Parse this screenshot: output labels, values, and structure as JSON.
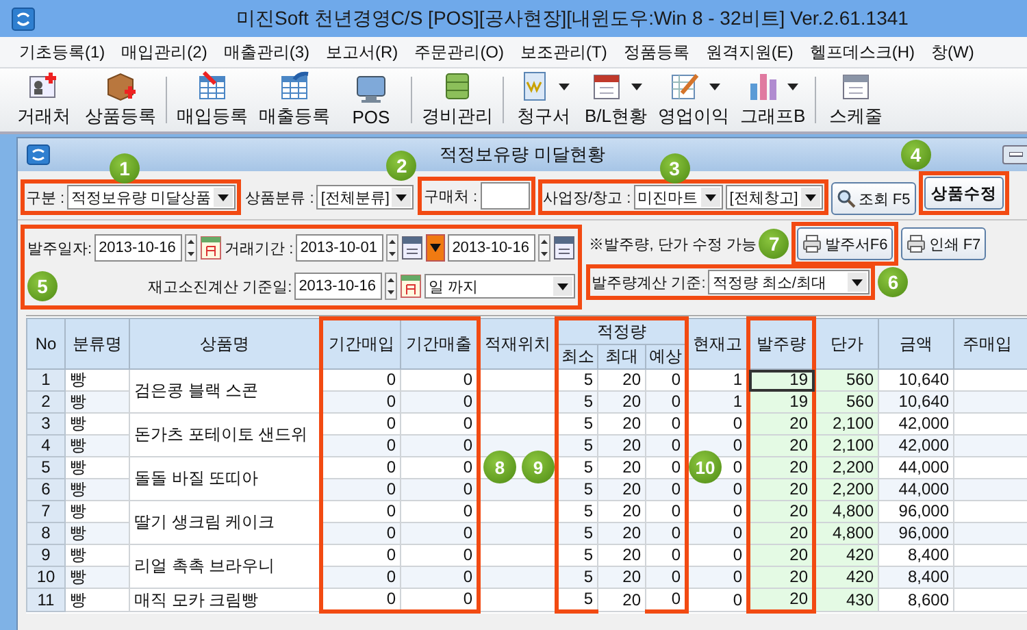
{
  "window": {
    "title": "미진Soft 천년경영C/S [POS][공사현장][내윈도우:Win 8 - 32비트] Ver.2.61.1341"
  },
  "menu": [
    "기초등록(1)",
    "매입관리(2)",
    "매출관리(3)",
    "보고서(R)",
    "주문관리(O)",
    "보조관리(T)",
    "정품등록",
    "원격지원(E)",
    "헬프데스크(H)",
    "창(W)"
  ],
  "toolbar": [
    {
      "kind": "button",
      "label": "거래처",
      "dropdown": false
    },
    {
      "kind": "button",
      "label": "상품등록",
      "dropdown": false
    },
    {
      "kind": "separator"
    },
    {
      "kind": "button",
      "label": "매입등록",
      "dropdown": false
    },
    {
      "kind": "button",
      "label": "매출등록",
      "dropdown": false
    },
    {
      "kind": "button",
      "label": "POS",
      "dropdown": false
    },
    {
      "kind": "separator"
    },
    {
      "kind": "button",
      "label": "경비관리",
      "dropdown": false
    },
    {
      "kind": "separator"
    },
    {
      "kind": "button",
      "label": "청구서",
      "dropdown": true
    },
    {
      "kind": "button",
      "label": "B/L현황",
      "dropdown": true
    },
    {
      "kind": "button",
      "label": "영업이익",
      "dropdown": true
    },
    {
      "kind": "button",
      "label": "그래프B",
      "dropdown": true
    },
    {
      "kind": "separator"
    },
    {
      "kind": "button",
      "label": "스케줄",
      "dropdown": false
    }
  ],
  "child_window": {
    "title": "적정보유량 미달현황"
  },
  "filter_row_1": {
    "type_label": "구분 :",
    "type_value": "적정보유량 미달상품",
    "category_label": "상품분류 :",
    "category_value": "[전체분류]",
    "supplier_label": "구매처 :",
    "site_label": "사업장/창고 :",
    "site_value": "미진마트",
    "warehouse_value": "[전체창고]",
    "search_button": "조회 F5",
    "edit_button": "상품수정"
  },
  "filter_row_2": {
    "order_date_label": "발주일자:",
    "order_date": "2013-10-16",
    "period_label": "거래기간 :",
    "period_from": "2013-10-01",
    "period_to": "2013-10-16",
    "note": "※발주량, 단가 수정 가능",
    "order_sheet_button": "발주서F6",
    "print_button": "인쇄 F7"
  },
  "filter_row_3": {
    "base_date_label": "재고소진계산 기준일:",
    "base_date": "2013-10-16",
    "until_value": "일 까지",
    "calc_label": "발주량계산 기준:",
    "calc_value": "적정량 최소/최대"
  },
  "table": {
    "columns": [
      {
        "label": "No"
      },
      {
        "label": "분류명"
      },
      {
        "label": "상품명"
      },
      {
        "label": "기간매입"
      },
      {
        "label": "기간매출"
      },
      {
        "label": "적재위치"
      },
      {
        "label": "적정량",
        "children": [
          {
            "label": "최소"
          },
          {
            "label": "최대"
          },
          {
            "label": "예상"
          }
        ]
      },
      {
        "label": "현재고"
      },
      {
        "label": "발주량"
      },
      {
        "label": "단가"
      },
      {
        "label": "금액"
      },
      {
        "label": "주매입"
      }
    ],
    "products": [
      {
        "name": "검은콩 블랙 스콘",
        "rows": [
          {
            "no": "1",
            "category": "빵",
            "cells": [
              "0",
              "0",
              "5",
              "20",
              "0",
              "1",
              "19",
              "560",
              "10,640"
            ],
            "selected": true
          },
          {
            "no": "2",
            "category": "빵",
            "cells": [
              "0",
              "0",
              "5",
              "20",
              "0",
              "1",
              "19",
              "560",
              "10,640"
            ],
            "selected": false
          }
        ]
      },
      {
        "name": "돈가츠 포테이토 샌드위",
        "rows": [
          {
            "no": "3",
            "category": "빵",
            "cells": [
              "0",
              "0",
              "5",
              "20",
              "0",
              "0",
              "20",
              "2,100",
              "42,000"
            ],
            "selected": false
          },
          {
            "no": "4",
            "category": "빵",
            "cells": [
              "0",
              "0",
              "5",
              "20",
              "0",
              "0",
              "20",
              "2,100",
              "42,000"
            ],
            "selected": false
          }
        ]
      },
      {
        "name": "돌돌 바질 또띠아",
        "rows": [
          {
            "no": "5",
            "category": "빵",
            "cells": [
              "0",
              "0",
              "5",
              "20",
              "0",
              "0",
              "20",
              "2,200",
              "44,000"
            ],
            "selected": false
          },
          {
            "no": "6",
            "category": "빵",
            "cells": [
              "0",
              "0",
              "5",
              "20",
              "0",
              "0",
              "20",
              "2,200",
              "44,000"
            ],
            "selected": false
          }
        ]
      },
      {
        "name": "딸기 생크림 케이크",
        "rows": [
          {
            "no": "7",
            "category": "빵",
            "cells": [
              "0",
              "0",
              "5",
              "20",
              "0",
              "0",
              "20",
              "4,800",
              "96,000"
            ],
            "selected": false
          },
          {
            "no": "8",
            "category": "빵",
            "cells": [
              "0",
              "0",
              "5",
              "20",
              "0",
              "0",
              "20",
              "4,800",
              "96,000"
            ],
            "selected": false
          }
        ]
      },
      {
        "name": "리얼 촉촉 브라우니",
        "rows": [
          {
            "no": "9",
            "category": "빵",
            "cells": [
              "0",
              "0",
              "5",
              "20",
              "0",
              "0",
              "20",
              "420",
              "8,400"
            ],
            "selected": false
          },
          {
            "no": "10",
            "category": "빵",
            "cells": [
              "0",
              "0",
              "5",
              "20",
              "0",
              "0",
              "20",
              "420",
              "8,400"
            ],
            "selected": false
          }
        ]
      },
      {
        "name": "매직 모카 크림빵",
        "rows": [
          {
            "no": "11",
            "category": "빵",
            "cells": [
              "0",
              "0",
              "5",
              "20",
              "0",
              "0",
              "20",
              "430",
              "8,600"
            ],
            "selected": false
          }
        ]
      }
    ]
  },
  "callouts": [
    {
      "number": "1"
    },
    {
      "number": "2"
    },
    {
      "number": "3"
    },
    {
      "number": "4"
    },
    {
      "number": "5"
    },
    {
      "number": "6"
    },
    {
      "number": "7"
    },
    {
      "number": "8"
    },
    {
      "number": "9"
    },
    {
      "number": "10"
    }
  ]
}
